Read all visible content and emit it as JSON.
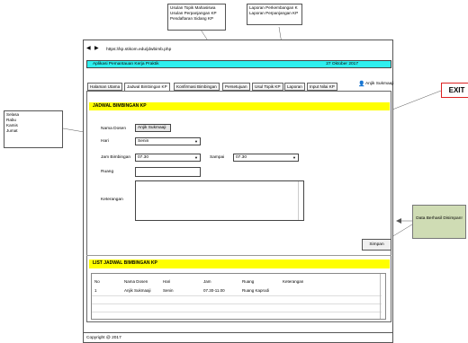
{
  "callouts": {
    "top_left": [
      "Usulan Topik Mahasiswa",
      "Usulan Perpanjangan KP",
      "Pendaftaran Sidang KP"
    ],
    "top_right": [
      "Laporan Perkembangan K",
      "Laporan Perpanjangan KP"
    ],
    "days": [
      "Selasa",
      "Rabu",
      "Kamis",
      "Jumat"
    ],
    "exit_label": "EXIT",
    "success_label": "Data Berhasil Disimpan!"
  },
  "browser": {
    "back": "◀",
    "forward": "▶",
    "url": "https://kp.stikom.edu/jdwbimb.php"
  },
  "appbar": {
    "title": "Aplikasi Pemantauan Kerja Praktik",
    "date": "27 Oktober 2017"
  },
  "tabs": [
    "Halaman Utama",
    "Jadwal Bimbingan KP",
    "Konfirmasi Bimbingan",
    "Persetujuan",
    "Usul Topik KP",
    "Laporan",
    "Input Nilai KP"
  ],
  "user": {
    "name": "Anjik Sukmaaji"
  },
  "form": {
    "section_title": "JADWAL BIMBINGAN KP",
    "nama_dosen_label": "Nama Dosen",
    "nama_dosen_value": "Anjik Sukmaaji",
    "hari_label": "Hari",
    "hari_value": "Senin",
    "jam_label": "Jam Bimbingan",
    "jam_value": "07.30",
    "sampai_label": "Sampai",
    "sampai_value": "07.30",
    "ruang_label": "Ruang",
    "ruang_value": "",
    "keterangan_label": "Keterangan",
    "keterangan_value": "",
    "save_label": "Simpan"
  },
  "list": {
    "section_title": "LIST JADWAL BIMBINGAN KP",
    "headers": [
      "No",
      "Nama Dosen",
      "Hari",
      "Jam",
      "Ruang",
      "Keterangan"
    ],
    "rows": [
      [
        "1",
        "Anjik Sukmaaji",
        "Senin",
        "07.30-11.00",
        "Ruang Kaprodi",
        ""
      ]
    ]
  },
  "footer": {
    "copyright": "Copyright @ 2017"
  }
}
